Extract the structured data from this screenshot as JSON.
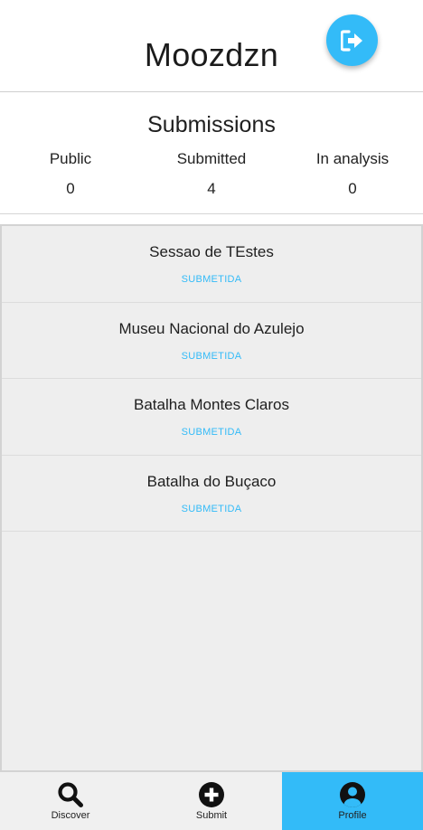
{
  "header": {
    "title": "Moozdzn",
    "logout_icon": "logout-icon"
  },
  "stats": {
    "title": "Submissions",
    "items": [
      {
        "label": "Public",
        "value": "0"
      },
      {
        "label": "Submitted",
        "value": "4"
      },
      {
        "label": "In analysis",
        "value": "0"
      }
    ]
  },
  "submissions": [
    {
      "name": "Sessao de TEstes",
      "status": "SUBMETIDA"
    },
    {
      "name": "Museu Nacional do Azulejo",
      "status": "SUBMETIDA"
    },
    {
      "name": "Batalha Montes Claros",
      "status": "SUBMETIDA"
    },
    {
      "name": "Batalha do Buçaco",
      "status": "SUBMETIDA"
    }
  ],
  "tabs": [
    {
      "label": "Discover",
      "icon": "search-icon"
    },
    {
      "label": "Submit",
      "icon": "plus-circle-icon"
    },
    {
      "label": "Profile",
      "icon": "user-circle-icon",
      "active": true
    }
  ],
  "colors": {
    "accent": "#33bbf8",
    "list_bg": "#eeeeee",
    "tabbar_bg": "#f0f0f0"
  }
}
